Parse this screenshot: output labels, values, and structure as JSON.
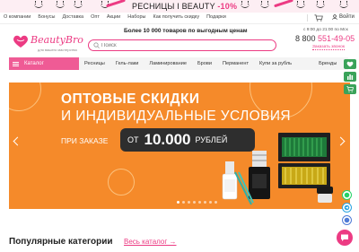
{
  "promo": {
    "text_main": "РЕСНИЦЫ I BEAUTY",
    "text_discount": "-10%"
  },
  "topnav": {
    "links": [
      "О компании",
      "Бонусы",
      "Доставка",
      "Опт",
      "Акции",
      "Наборы",
      "Как получить скидку",
      "Подарки"
    ],
    "login_label": "Войти"
  },
  "header": {
    "logo_name": "BeautyBro",
    "logo_sub": "для вашего мастерства",
    "tagline": "Более 10 000 товаров по выгодным ценам",
    "search_placeholder": "Поиск",
    "hours": "с 9:00 до 21:00 по Мск",
    "phone_prefix": "8 800",
    "phone_main": "551-49-05",
    "callback_label": "Заказать звонок"
  },
  "catbar": {
    "catalog_label": "Каталог",
    "items": [
      "Ресницы",
      "Гель-лаки",
      "Ламинирование",
      "Брови",
      "Перманент",
      "Купи за рубль",
      "Бренды"
    ]
  },
  "banner": {
    "line1": "ОПТОВЫЕ СКИДКИ",
    "line2": "И ИНДИВИДУАЛЬНЫЕ УСЛОВИЯ",
    "line3": "ПРИ ЗАКАЗЕ",
    "pill_from": "ОТ",
    "pill_amount": "10.000",
    "pill_currency": "РУБЛЕЙ",
    "slide_count": 8,
    "active_slide": 0
  },
  "popular": {
    "title": "Популярные категории",
    "all_link": "Весь каталог →"
  },
  "colors": {
    "accent": "#ec3b83",
    "banner": "#f58a2a",
    "pill": "#2e2e2e"
  }
}
